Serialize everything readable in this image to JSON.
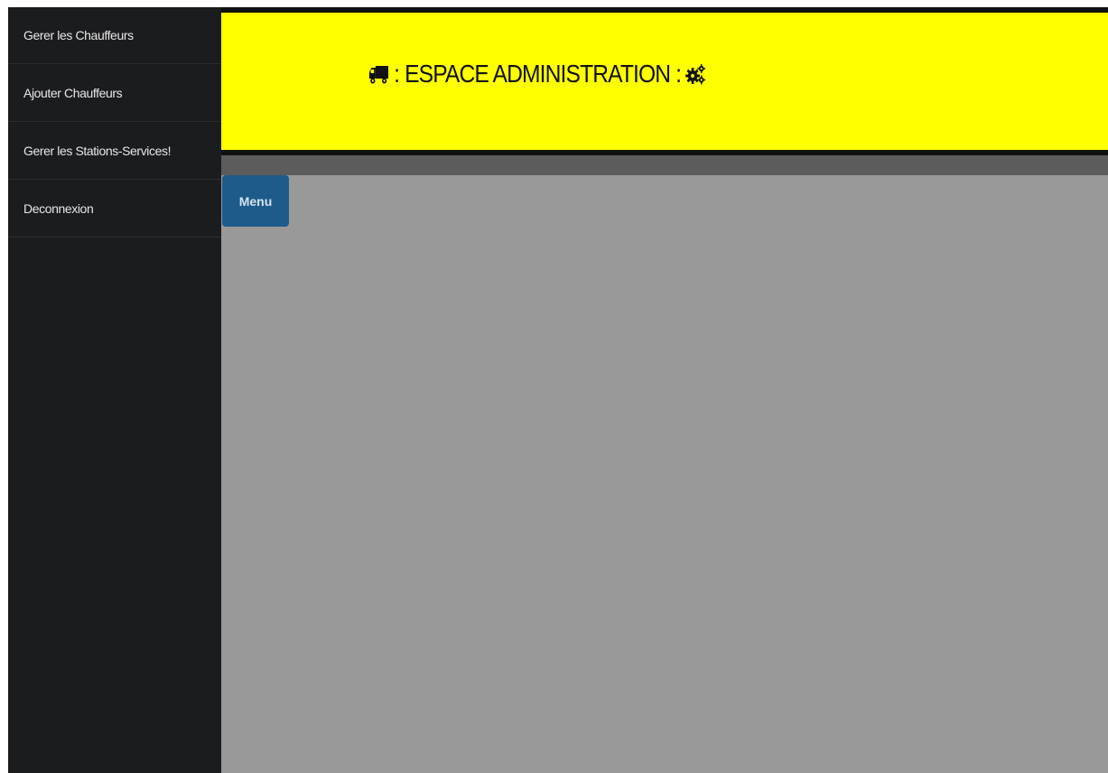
{
  "sidebar": {
    "items": [
      {
        "label": "Gerer les Chauffeurs"
      },
      {
        "label": "Ajouter Chauffeurs"
      },
      {
        "label": "Gerer les Stations-Services!"
      },
      {
        "label": "Deconnexion"
      }
    ]
  },
  "header": {
    "title": ": ESPACE ADMINISTRATION :",
    "leading_icon": "truck-icon",
    "trailing_icon": "gears-icon",
    "background_color": "#ffff00"
  },
  "toolbar": {
    "menu_label": "Menu"
  },
  "colors": {
    "sidebar": "#1b1c1e",
    "content_background": "#999999",
    "menu_button": "#1d5b8a"
  }
}
